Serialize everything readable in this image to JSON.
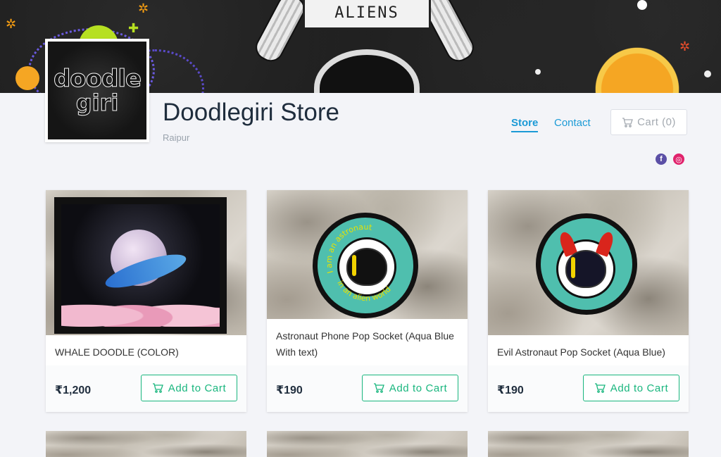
{
  "banner": {
    "sign_text": "ALIENS"
  },
  "store": {
    "logo_line1": "doodle",
    "logo_line2": "giri",
    "name": "Doodlegiri Store",
    "location": "Raipur"
  },
  "nav": {
    "store_label": "Store",
    "contact_label": "Contact",
    "cart_label": "Cart (0)"
  },
  "social": {
    "facebook_icon": "f",
    "instagram_icon": "◎"
  },
  "products": [
    {
      "title": "WHALE DOODLE (COLOR)",
      "price": "₹1,200",
      "button": "Add to Cart"
    },
    {
      "title": "Astronaut Phone Pop Socket (Aqua Blue With text)",
      "price": "₹190",
      "button": "Add to Cart",
      "pin_text_top": "I am an astronaut",
      "pin_text_bottom": "in an alien world"
    },
    {
      "title": "Evil Astronaut Pop Socket (Aqua Blue)",
      "price": "₹190",
      "button": "Add to Cart"
    }
  ],
  "colors": {
    "accent_blue": "#1b9ad6",
    "accent_green": "#19b67e",
    "text_dark": "#1f2d3d",
    "bg": "#f3f4f8"
  }
}
